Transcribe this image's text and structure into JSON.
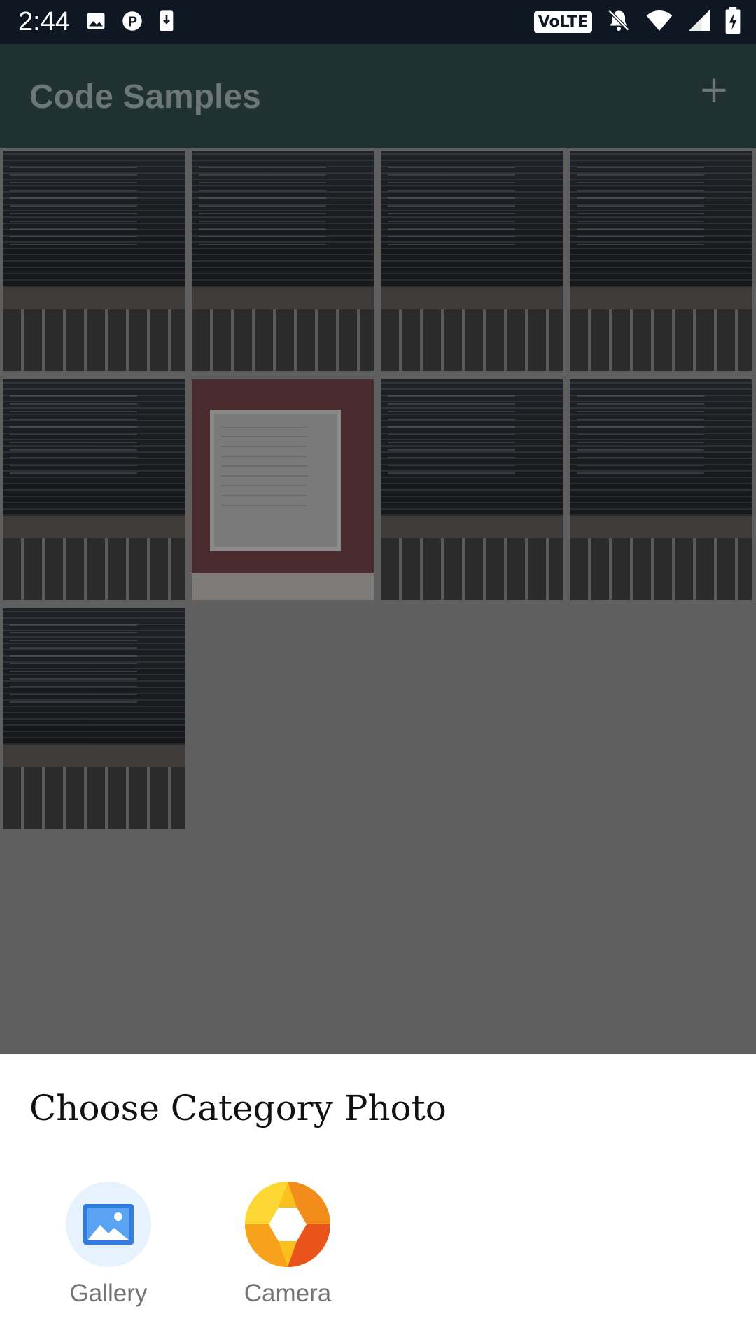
{
  "status_bar": {
    "time": "2:44",
    "left_icons": [
      "image-icon",
      "p-app-icon",
      "download-icon"
    ],
    "right_icons": [
      "volte-icon",
      "notifications-off-icon",
      "wifi-icon",
      "signal-icon",
      "battery-icon"
    ],
    "volte_label": "VoLTE"
  },
  "app_bar": {
    "title": "Code Samples",
    "add_icon": "plus-icon"
  },
  "grid": {
    "items": [
      {
        "kind": "code-screen"
      },
      {
        "kind": "code-screen"
      },
      {
        "kind": "code-screen"
      },
      {
        "kind": "code-screen"
      },
      {
        "kind": "code-screen"
      },
      {
        "kind": "laptop-browser"
      },
      {
        "kind": "code-screen"
      },
      {
        "kind": "code-screen"
      },
      {
        "kind": "code-screen"
      }
    ]
  },
  "sheet": {
    "title": "Choose Category Photo",
    "options": [
      {
        "label": "Gallery",
        "icon": "gallery-icon"
      },
      {
        "label": "Camera",
        "icon": "camera-icon"
      }
    ]
  },
  "colors": {
    "status_bar_bg": "#0e1722",
    "app_bar_bg_dimmed": "#1f3130",
    "scrim": "#5f5f5f",
    "sheet_bg": "#ffffff",
    "gallery_bg": "#e6f2fd",
    "camera_bg": "#fbbf1e"
  }
}
